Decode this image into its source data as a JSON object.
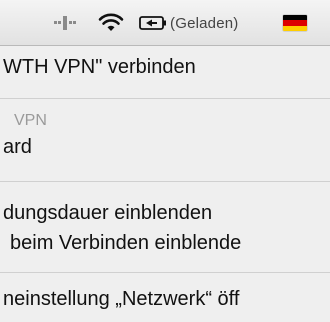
{
  "menubar": {
    "vpn_icon": "vpn-status-icon",
    "wifi_icon": "wifi-icon",
    "battery_icon": "battery-charging-icon",
    "battery_status": "(Geladen)",
    "input_source_icon": "german-flag-icon",
    "flag_colors": [
      "#000000",
      "#dd0000",
      "#ffce00"
    ]
  },
  "menu": {
    "connect_label": "WTH VPN\" verbinden",
    "section_header": "VPN",
    "section_value": "ard",
    "show_duration_label": "dungsdauer einblenden",
    "show_on_connect_label": "beim Verbinden einblende",
    "open_network_prefs_label": "neinstellung „Netzwerk“ öff"
  }
}
